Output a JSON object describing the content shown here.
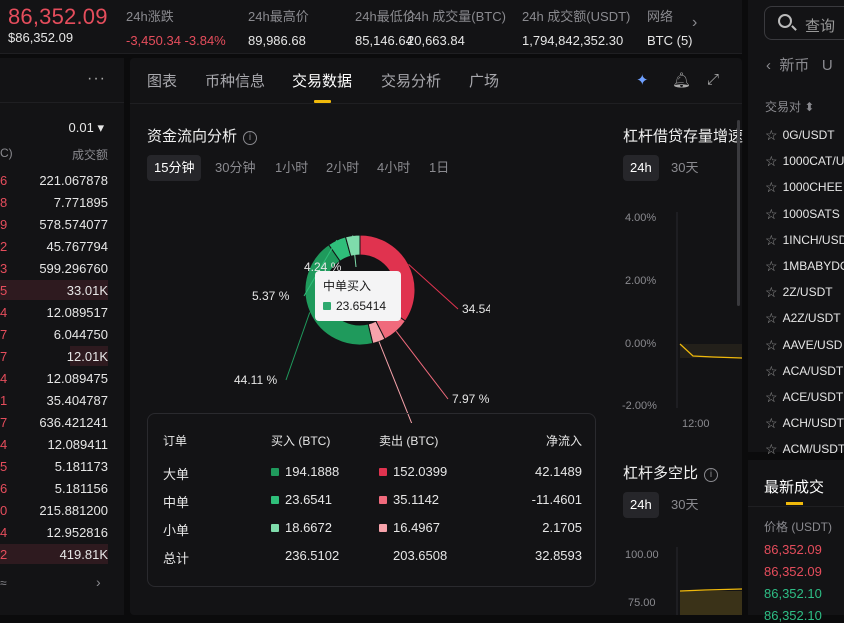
{
  "ticker": {
    "price": "86,352.09",
    "price_sub": "$86,352.09",
    "stats": [
      {
        "label": "24h涨跌",
        "value": "-3,450.34 -3.84%",
        "negative": true
      },
      {
        "label": "24h最高价",
        "value": "89,986.68"
      },
      {
        "label": "24h最低价",
        "value": "85,146.64"
      },
      {
        "label": "24h 成交量(BTC)",
        "value": "20,663.84"
      },
      {
        "label": "24h 成交额(USDT)",
        "value": "1,794,842,352.30"
      },
      {
        "label": "网络",
        "value": "BTC (5)"
      }
    ]
  },
  "orderbook": {
    "precision": "0.01 ▾",
    "col_price": "C)",
    "col_volume": "成交额",
    "rows": [
      {
        "p": "6",
        "a": "221.067878",
        "hl": 0
      },
      {
        "p": "8",
        "a": "7.771895",
        "hl": 0
      },
      {
        "p": "9",
        "a": "578.574077",
        "hl": 0
      },
      {
        "p": "2",
        "a": "45.767794",
        "hl": 0
      },
      {
        "p": "3",
        "a": "599.296760",
        "hl": 0
      },
      {
        "p": "5",
        "a": "33.01K",
        "hl": 1
      },
      {
        "p": "4",
        "a": "12.089517",
        "hl": 0
      },
      {
        "p": "7",
        "a": "6.044750",
        "hl": 0
      },
      {
        "p": "7",
        "a": "12.01K",
        "hl": 0.35
      },
      {
        "p": "4",
        "a": "12.089475",
        "hl": 0
      },
      {
        "p": "1",
        "a": "35.404787",
        "hl": 0
      },
      {
        "p": "7",
        "a": "636.421241",
        "hl": 0
      },
      {
        "p": "4",
        "a": "12.089411",
        "hl": 0
      },
      {
        "p": "5",
        "a": "5.181173",
        "hl": 0
      },
      {
        "p": "6",
        "a": "5.181156",
        "hl": 0
      },
      {
        "p": "0",
        "a": "215.881200",
        "hl": 0
      },
      {
        "p": "4",
        "a": "12.952816",
        "hl": 0
      },
      {
        "p": "2",
        "a": "419.81K",
        "hl": 1
      }
    ]
  },
  "tabs": [
    "图表",
    "币种信息",
    "交易数据",
    "交易分析",
    "广场"
  ],
  "fund_flow": {
    "title": "资金流向分析",
    "intervals": [
      "15分钟",
      "30分钟",
      "1小时",
      "2小时",
      "4小时",
      "1日"
    ],
    "tooltip": {
      "label": "中单买入",
      "value": "23.65414"
    },
    "table": {
      "headers": [
        "订单",
        "买入 (BTC)",
        "卖出 (BTC)",
        "净流入"
      ],
      "rows": [
        {
          "name": "大单",
          "buy": "194.1888",
          "sell": "152.0399",
          "net": "42.1489"
        },
        {
          "name": "中单",
          "buy": "23.6541",
          "sell": "35.1142",
          "net": "-11.4601"
        },
        {
          "name": "小单",
          "buy": "18.6672",
          "sell": "16.4967",
          "net": "2.1705"
        },
        {
          "name": "总计",
          "buy": "236.5102",
          "sell": "203.6508",
          "net": "32.8593"
        }
      ]
    }
  },
  "chart_data": {
    "type": "pie",
    "title": "资金流向分析",
    "slices": [
      {
        "label": "34.54 %",
        "value": 34.54,
        "color": "#e0334f"
      },
      {
        "label": "7.97 %",
        "value": 7.97,
        "color": "#f06a7c"
      },
      {
        "label": "3.74 %",
        "value": 3.74,
        "color": "#f7a3ab"
      },
      {
        "label": "44.11 %",
        "value": 44.11,
        "color": "#1f9a5c"
      },
      {
        "label": "5.37 %",
        "value": 5.37,
        "color": "#2fbf7a"
      },
      {
        "label": "4.24 %",
        "value": 4.24,
        "color": "#7fdcab"
      }
    ]
  },
  "margin_chart": {
    "title": "杠杆借贷存量增速",
    "pills": [
      "24h",
      "30天"
    ],
    "y_ticks": [
      "4.00%",
      "2.00%",
      "0.00%",
      "-2.00%"
    ],
    "x_tick": "12:00"
  },
  "ls_chart": {
    "title": "杠杆多空比",
    "pills": [
      "24h",
      "30天"
    ],
    "y_ticks": [
      "100.00",
      "75.00"
    ]
  },
  "market": {
    "search_placeholder": "查询",
    "new_tab": "新币",
    "new_tab_2": "U",
    "pair_header": "交易对 ⬍",
    "pairs": [
      "0G/USDT",
      "1000CAT/U",
      "1000CHEE",
      "1000SATS",
      "1INCH/USD",
      "1MBABYDO",
      "2Z/USDT",
      "A2Z/USDT",
      "AAVE/USD",
      "ACA/USDT",
      "ACE/USDT",
      "ACH/USDT",
      "ACM/USDT"
    ]
  },
  "recent_trades": {
    "title": "最新成交",
    "header": "价格 (USDT)",
    "prices": [
      {
        "v": "86,352.09",
        "c": "#e54d5c"
      },
      {
        "v": "86,352.09",
        "c": "#e54d5c"
      },
      {
        "v": "86,352.10",
        "c": "#2ebd85"
      },
      {
        "v": "86,352.10",
        "c": "#2ebd85"
      }
    ]
  },
  "colors": {
    "up": "#2ebd85",
    "down": "#e54d5c",
    "accent": "#f0b90b"
  }
}
